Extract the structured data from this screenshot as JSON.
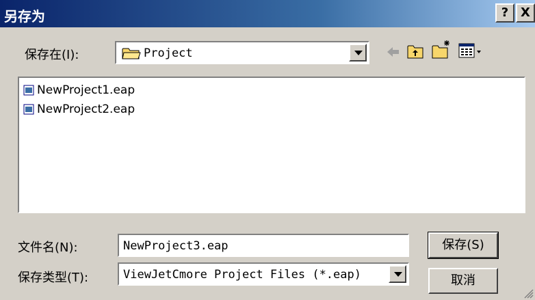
{
  "title": "另存为",
  "help_label": "?",
  "close_label": "X",
  "save_in": {
    "label": "保存在(I):",
    "value": "Project"
  },
  "files": [
    {
      "name": "NewProject1.eap"
    },
    {
      "name": "NewProject2.eap"
    }
  ],
  "filename": {
    "label": "文件名(N):",
    "value": "NewProject3.eap"
  },
  "filetype": {
    "label": "保存类型(T):",
    "value": "ViewJetCmore Project Files (*.eap)"
  },
  "buttons": {
    "save": "保存(S)",
    "cancel": "取消"
  }
}
